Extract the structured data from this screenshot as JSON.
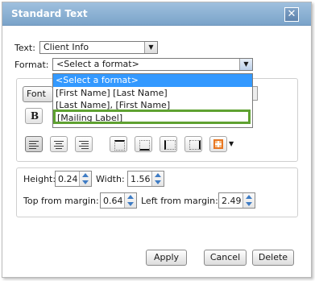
{
  "dialog": {
    "title": "Standard Text",
    "close_label": "✕"
  },
  "text_field": {
    "label": "Text:",
    "value": "Client Info"
  },
  "format_field": {
    "label": "Format:",
    "value": "<Select a format>",
    "options": [
      "<Select a format>",
      "[First Name] [Last Name]",
      "[Last Name], [First Name]",
      "[Mailing Label]"
    ],
    "selected_index": 0,
    "highlighted_option": "[Mailing Label]"
  },
  "font": {
    "button_label": "Font",
    "bold_label": "B"
  },
  "dimensions": {
    "height_label": "Height:",
    "height_value": "0.24",
    "width_label": "Width:",
    "width_value": "1.56",
    "top_label": "Top from margin:",
    "top_value": "0.64",
    "left_label": "Left from margin:",
    "left_value": "2.49"
  },
  "buttons": {
    "apply": "Apply",
    "cancel": "Cancel",
    "delete": "Delete"
  },
  "colors": {
    "titlebar": "#8cb2d6",
    "selection": "#3399ff",
    "highlight": "#5fa131",
    "border_icon": "#e87722"
  }
}
